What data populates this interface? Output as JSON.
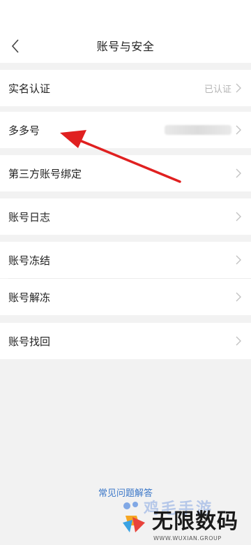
{
  "header": {
    "title": "账号与安全",
    "back_icon": "chevron-left-icon"
  },
  "sections": [
    {
      "label": "实名认证",
      "value": "已认证",
      "icon": "chevron-right-icon"
    },
    {
      "label": "多多号",
      "value_obscured": true,
      "icon": "chevron-right-icon"
    },
    {
      "label": "第三方账号绑定",
      "icon": "chevron-right-icon"
    },
    {
      "label": "账号日志",
      "icon": "chevron-right-icon"
    },
    {
      "label": "账号冻结",
      "icon": "chevron-right-icon"
    },
    {
      "label": "账号解冻",
      "icon": "chevron-right-icon"
    },
    {
      "label": "账号找回",
      "icon": "chevron-right-icon"
    }
  ],
  "footer": {
    "faq_link": "常见问题解答"
  },
  "watermark": {
    "top_text": "鸡毛手游",
    "main_text": "无限数码",
    "url": "WWW.WUXIAN.GROUP"
  },
  "colors": {
    "annotation_arrow": "#e02020",
    "faq_link": "#3b77c8",
    "page_bg": "#f2f2f2"
  }
}
